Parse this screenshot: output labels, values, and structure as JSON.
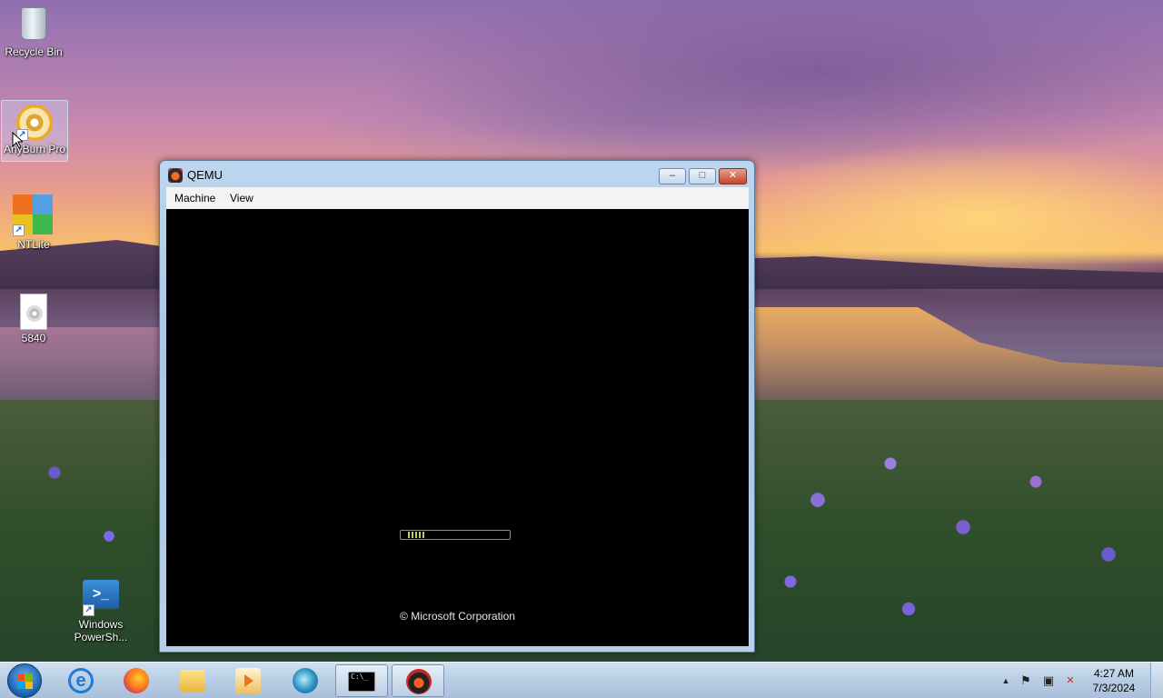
{
  "desktop": {
    "icons": [
      {
        "label": "Recycle Bin",
        "icon": "recycle-bin-icon"
      },
      {
        "label": "AnyBurn Pro",
        "icon": "anyburn-disc-icon",
        "selected": true
      },
      {
        "label": "NTLite",
        "icon": "ntlite-icon"
      },
      {
        "label": "5840",
        "icon": "disc-image-file-icon"
      },
      {
        "label": "Windows\nPowerSh...",
        "icon": "powershell-icon"
      }
    ]
  },
  "window": {
    "title": "QEMU",
    "controls": {
      "minimize": "–",
      "maximize": "□",
      "close": "✕"
    },
    "menu": [
      "Machine",
      "View"
    ],
    "screen": {
      "boot_progress_fraction": 0.17,
      "copyright": "© Microsoft Corporation"
    }
  },
  "taskbar": {
    "pinned": [
      {
        "name": "Internet Explorer",
        "icon": "internet-explorer-icon",
        "glyph": "e"
      },
      {
        "name": "Firefox",
        "icon": "firefox-icon"
      },
      {
        "name": "File Explorer",
        "icon": "folder-icon"
      },
      {
        "name": "Media Player",
        "icon": "media-player-icon"
      },
      {
        "name": "AnyBurn",
        "icon": "anyburn-icon"
      },
      {
        "name": "Command Prompt",
        "icon": "command-prompt-icon",
        "glyph": "C:\\_"
      },
      {
        "name": "QEMU",
        "icon": "qemu-icon",
        "active": true
      }
    ],
    "tray": {
      "show_hidden": "▲",
      "action_center": "⚑",
      "network": "▣",
      "volume": "✕"
    },
    "clock": {
      "time": "4:27 AM",
      "date": "7/3/2024"
    }
  }
}
